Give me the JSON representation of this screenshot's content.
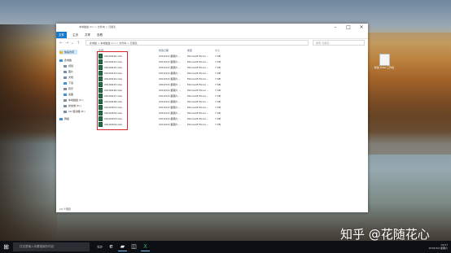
{
  "window": {
    "title": "本地磁盘 (C:) > 文件夹 > 日报表",
    "ribbon_tabs": [
      "文件",
      "主页",
      "共享",
      "查看"
    ],
    "address": "此电脑 > 本地磁盘 (C:) > 文件夹 > 日报表",
    "search_placeholder": "搜索\"日报表\""
  },
  "nav_pane": {
    "items": [
      {
        "label": "快速访问",
        "icon": "star-icon",
        "color": "#f2b51c"
      },
      {
        "label": "此电脑",
        "icon": "computer-icon",
        "color": "#3f93d8"
      },
      {
        "label": "视频",
        "icon": "video-icon",
        "color": "#7a8ea6"
      },
      {
        "label": "图片",
        "icon": "pictures-icon",
        "color": "#7a8ea6"
      },
      {
        "label": "文档",
        "icon": "documents-icon",
        "color": "#7a8ea6"
      },
      {
        "label": "下载",
        "icon": "download-icon",
        "color": "#3f93d8"
      },
      {
        "label": "音乐",
        "icon": "music-icon",
        "color": "#7a8ea6"
      },
      {
        "label": "桌面",
        "icon": "desktop-icon",
        "color": "#3f93d8"
      },
      {
        "label": "本地磁盘 (C:)",
        "icon": "drive-icon",
        "color": "#7a8ea6"
      },
      {
        "label": "新加卷 (D:)",
        "icon": "drive-icon",
        "color": "#7a8ea6"
      },
      {
        "label": "CD 驱动器 (E:)",
        "icon": "cd-drive-icon",
        "color": "#7a8ea6"
      },
      {
        "label": "网络",
        "icon": "network-icon",
        "color": "#3f93d8"
      }
    ]
  },
  "file_list": {
    "columns": [
      "名称",
      "修改日期",
      "类型",
      "大小"
    ],
    "rows": [
      {
        "name": "20190220.xlsx",
        "date": "2019/3/2 星期六 ...",
        "type": "Microsoft Excel ...",
        "size": "7 KB"
      },
      {
        "name": "20190221.xlsx",
        "date": "2019/3/2 星期六 ...",
        "type": "Microsoft Excel ...",
        "size": "7 KB"
      },
      {
        "name": "20190222.xlsx",
        "date": "2019/3/2 星期六 ...",
        "type": "Microsoft Excel ...",
        "size": "7 KB"
      },
      {
        "name": "20190223.xlsx",
        "date": "2019/3/2 星期六 ...",
        "type": "Microsoft Excel ...",
        "size": "7 KB"
      },
      {
        "name": "20190224.xlsx",
        "date": "2019/3/2 星期六 ...",
        "type": "Microsoft Excel ...",
        "size": "7 KB"
      },
      {
        "name": "20190225.xlsx",
        "date": "2019/3/2 星期六 ...",
        "type": "Microsoft Excel ...",
        "size": "7 KB"
      },
      {
        "name": "20190226.xlsx",
        "date": "2019/3/2 星期六 ...",
        "type": "Microsoft Excel ...",
        "size": "7 KB"
      },
      {
        "name": "20190227.xlsx",
        "date": "2019/3/2 星期六 ...",
        "type": "Microsoft Excel ...",
        "size": "7 KB"
      },
      {
        "name": "20190228.xlsx",
        "date": "2019/3/2 星期六 ...",
        "type": "Microsoft Excel ...",
        "size": "7 KB"
      },
      {
        "name": "20190301.xlsx",
        "date": "2019/3/2 星期六 ...",
        "type": "Microsoft Excel ...",
        "size": "7 KB"
      },
      {
        "name": "20190302.xlsx",
        "date": "2019/3/2 星期六 ...",
        "type": "Microsoft Excel ...",
        "size": "7 KB"
      },
      {
        "name": "20190303.xlsx",
        "date": "2019/3/2 星期六 ...",
        "type": "Microsoft Excel ...",
        "size": "7 KB"
      },
      {
        "name": "20190304.xlsx",
        "date": "2019/3/2 星期六 ...",
        "type": "Microsoft Excel ...",
        "size": "7 KB"
      }
    ],
    "highlight_color": "#d62828"
  },
  "status": {
    "items_text": "13 个项目"
  },
  "desktop": {
    "icon_label": "新建 XLSX 工作表"
  },
  "watermark": "知乎 @花随花心",
  "taskbar": {
    "search_placeholder": "在这里输入你要搜索的内容",
    "apps": [
      "task-view-icon",
      "edge-icon",
      "file-explorer-icon",
      "store-icon",
      "excel-icon"
    ],
    "tray_time": "19:07",
    "tray_date": "2019/3/2 星期六"
  }
}
